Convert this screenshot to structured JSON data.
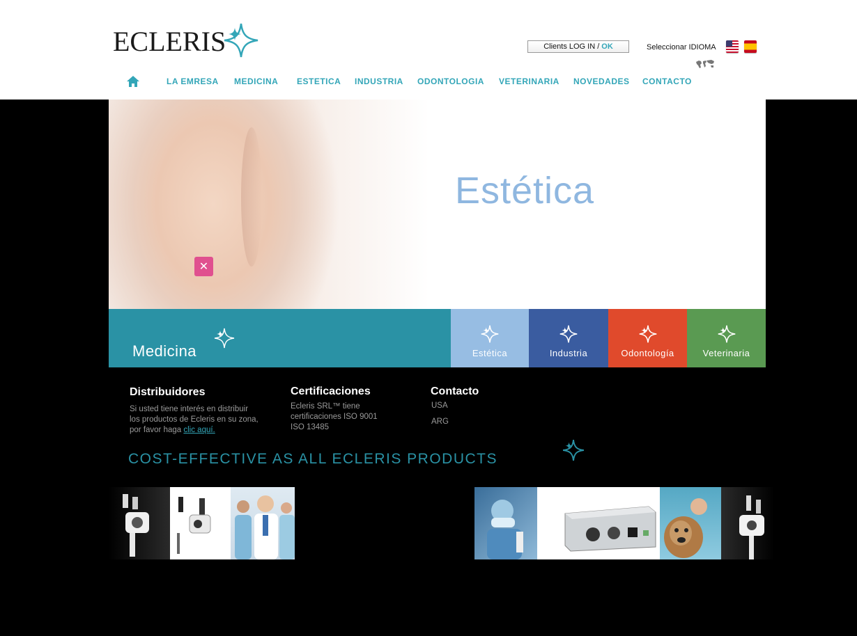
{
  "brand": {
    "name": "ECLERIS"
  },
  "login": {
    "prefix": "Clients LOG IN /",
    "ok": "OK"
  },
  "language": {
    "label": "Seleccionar IDIOMA"
  },
  "nav": {
    "items": [
      "LA EMRESA",
      "MEDICINA",
      "ESTETICA",
      "INDUSTRIA",
      "ODONTOLOGIA",
      "VETERINARIA",
      "NOVEDADES",
      "CONTACTO"
    ]
  },
  "hero": {
    "title": "Estética"
  },
  "band": {
    "main": {
      "label": "Medicina"
    },
    "tiles": [
      {
        "label": "Estética",
        "color": "#97bde3"
      },
      {
        "label": "Industria",
        "color": "#3a5ca0"
      },
      {
        "label": "Odontología",
        "color": "#e04a2c"
      },
      {
        "label": "Veterinaria",
        "color": "#5a9a52"
      }
    ]
  },
  "distribuidores": {
    "title": "Distribuidores",
    "line1": "Si usted tiene interés en distribuir",
    "line2": "los productos de Ecleris en su zona,",
    "line3_prefix": "por favor haga",
    "link": "clic aquí."
  },
  "certificaciones": {
    "title": "Certificaciones",
    "line1": "Ecleris SRL™ tiene",
    "line2": "certificaciones ISO 9001",
    "line3": "ISO 13485"
  },
  "contacto": {
    "title": "Contacto",
    "links": [
      "USA",
      "ARG"
    ]
  },
  "slogan": "COST-EFFECTIVE AS ALL ECLERIS PRODUCTS",
  "colors": {
    "accent": "#33a6b8",
    "teal_band": "#2a92a5"
  }
}
